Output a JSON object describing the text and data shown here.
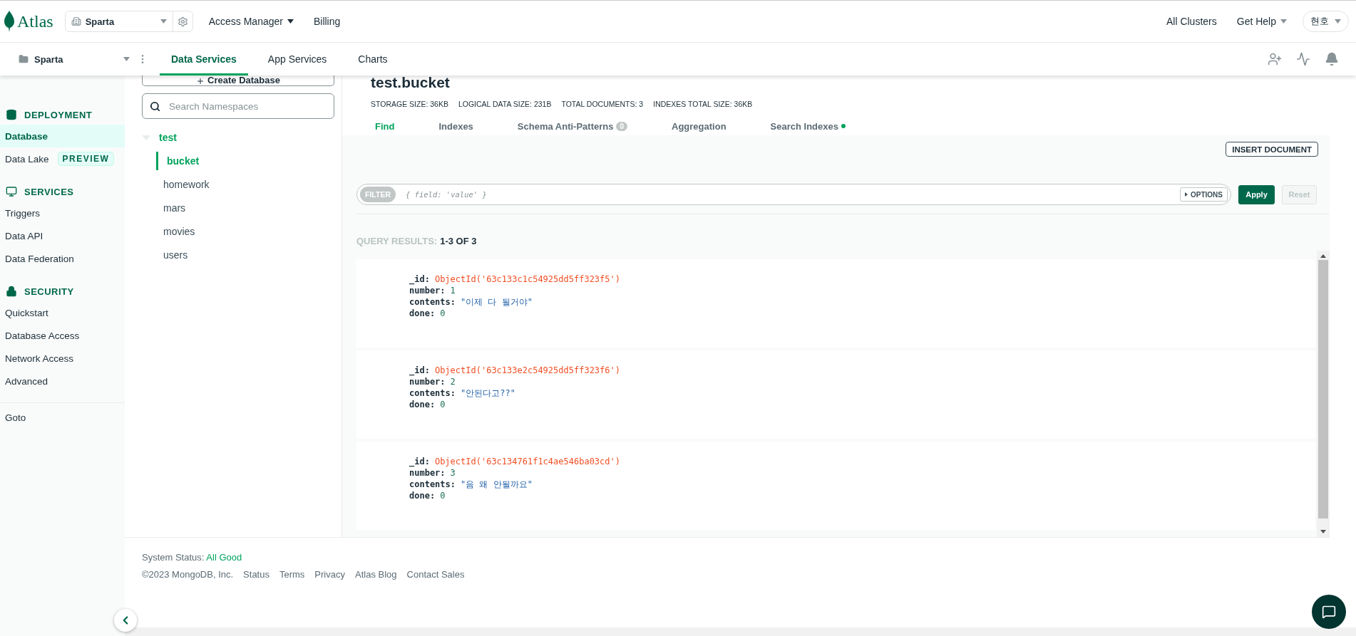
{
  "top_bar": {
    "logo": "Atlas",
    "organization": "Sparta",
    "nav": [
      {
        "label": "Access Manager",
        "dropdown": true
      },
      {
        "label": "Billing",
        "dropdown": false
      }
    ],
    "right": [
      {
        "label": "All Clusters",
        "dropdown": false
      },
      {
        "label": "Get Help",
        "dropdown": true
      }
    ],
    "user": "현호"
  },
  "project_bar": {
    "project": "Sparta",
    "tabs": [
      {
        "label": "Data Services",
        "selected": true
      },
      {
        "label": "App Services",
        "selected": false
      },
      {
        "label": "Charts",
        "selected": false
      }
    ]
  },
  "sidebar": {
    "sections": [
      {
        "title": "DEPLOYMENT",
        "kind": "database",
        "items": [
          {
            "label": "Database",
            "selected": true
          },
          {
            "label": "Data Lake",
            "selected": false,
            "badge": "PREVIEW"
          }
        ]
      },
      {
        "title": "SERVICES",
        "kind": "services",
        "items": [
          {
            "label": "Triggers",
            "selected": false
          },
          {
            "label": "Data API",
            "selected": false
          },
          {
            "label": "Data Federation",
            "selected": false
          }
        ]
      },
      {
        "title": "SECURITY",
        "kind": "security",
        "items": [
          {
            "label": "Quickstart",
            "selected": false
          },
          {
            "label": "Database Access",
            "selected": false
          },
          {
            "label": "Network Access",
            "selected": false
          },
          {
            "label": "Advanced",
            "selected": false
          }
        ]
      }
    ],
    "goto": "Goto"
  },
  "namespaces": {
    "create_button": "Create Database",
    "search_placeholder": "Search Namespaces",
    "databases": [
      {
        "name": "test",
        "expanded": true,
        "children": [
          {
            "name": "bucket",
            "selected": true
          },
          {
            "name": "homework",
            "selected": false
          },
          {
            "name": "mars",
            "selected": false
          },
          {
            "name": "movies",
            "selected": false
          },
          {
            "name": "users",
            "selected": false
          }
        ]
      }
    ]
  },
  "collection": {
    "title": "test.bucket",
    "stats": [
      "STORAGE SIZE: 36KB",
      "LOGICAL DATA SIZE: 231B",
      "TOTAL DOCUMENTS: 3",
      "INDEXES TOTAL SIZE: 36KB"
    ],
    "tabs": [
      {
        "label": "Find",
        "selected": true
      },
      {
        "label": "Indexes",
        "selected": false
      },
      {
        "label": "Schema Anti-Patterns",
        "selected": false,
        "badge": "0"
      },
      {
        "label": "Aggregation",
        "selected": false
      },
      {
        "label": "Search Indexes",
        "selected": false,
        "dot": true
      }
    ],
    "insert_button": "INSERT DOCUMENT",
    "filter": {
      "tag": "FILTER",
      "placeholder": "{ field: 'value' }",
      "options": "OPTIONS",
      "apply": "Apply",
      "reset": "Reset",
      "reset_disabled": true
    },
    "results_label": "QUERY RESULTS:",
    "results_count": "1-3 OF 3",
    "documents": [
      {
        "fields": [
          {
            "key": "_id:",
            "value": "ObjectId('63c133c1c54925dd5ff323f5')",
            "kind": "objectid"
          },
          {
            "key": "number:",
            "value": "1",
            "kind": "number"
          },
          {
            "key": "contents:",
            "value": "\"이제 다 될거야\"",
            "kind": "string"
          },
          {
            "key": "done:",
            "value": "0",
            "kind": "number"
          }
        ]
      },
      {
        "fields": [
          {
            "key": "_id:",
            "value": "ObjectId('63c133e2c54925dd5ff323f6')",
            "kind": "objectid"
          },
          {
            "key": "number:",
            "value": "2",
            "kind": "number"
          },
          {
            "key": "contents:",
            "value": "\"안된다고??\"",
            "kind": "string"
          },
          {
            "key": "done:",
            "value": "0",
            "kind": "number"
          }
        ]
      },
      {
        "fields": [
          {
            "key": "_id:",
            "value": "ObjectId('63c134761f1c4ae546ba03cd')",
            "kind": "objectid"
          },
          {
            "key": "number:",
            "value": "3",
            "kind": "number"
          },
          {
            "key": "contents:",
            "value": "\"음 왜 안될까요\"",
            "kind": "string"
          },
          {
            "key": "done:",
            "value": "0",
            "kind": "number"
          }
        ]
      }
    ]
  },
  "footer": {
    "status_label": "System Status:",
    "status_value": "All Good",
    "copyright": "©2023 MongoDB, Inc.",
    "links": [
      "Status",
      "Terms",
      "Privacy",
      "Atlas Blog",
      "Contact Sales"
    ]
  }
}
